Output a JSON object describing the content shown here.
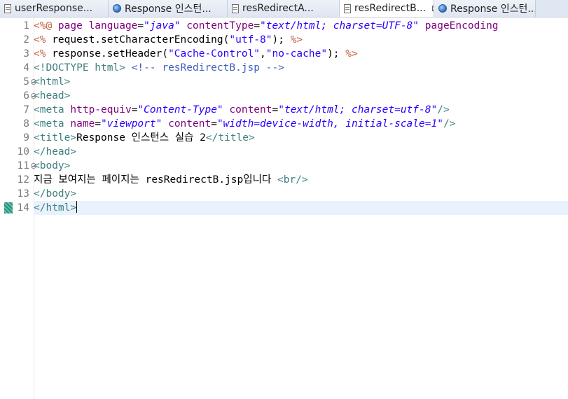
{
  "tabs": [
    {
      "label": "userResponse...",
      "icon": "jsp-file-icon",
      "active": false
    },
    {
      "label": "Response 인스턴...",
      "icon": "globe-icon",
      "active": false
    },
    {
      "label": "resRedirectA...",
      "icon": "jsp-file-icon",
      "active": false
    },
    {
      "label": "resRedirectB...",
      "icon": "jsp-file-icon",
      "active": true,
      "close": "⊠"
    },
    {
      "label": "Response 인스턴...",
      "icon": "globe-icon",
      "active": false
    }
  ],
  "editor": {
    "current_line": 14,
    "lines": [
      {
        "num": "1",
        "tokens": [
          [
            "dir",
            "<%@ "
          ],
          [
            "attr",
            "page "
          ],
          [
            "attr",
            "language"
          ],
          [
            "txt",
            "="
          ],
          [
            "stri",
            "\"java\""
          ],
          [
            "txt",
            " "
          ],
          [
            "attr",
            "contentType"
          ],
          [
            "txt",
            "="
          ],
          [
            "stri",
            "\"text/html; charset=UTF-8\""
          ],
          [
            "txt",
            " "
          ],
          [
            "attr",
            "pageEncoding"
          ]
        ]
      },
      {
        "num": "2",
        "tokens": [
          [
            "dir",
            "<% "
          ],
          [
            "java",
            "request.setCharacterEncoding("
          ],
          [
            "str",
            "\"utf-8\""
          ],
          [
            "java",
            "); "
          ],
          [
            "dir",
            "%>"
          ]
        ]
      },
      {
        "num": "3",
        "tokens": [
          [
            "dir",
            "<% "
          ],
          [
            "java",
            "response.setHeader("
          ],
          [
            "str",
            "\"Cache-Control\""
          ],
          [
            "java",
            ","
          ],
          [
            "str",
            "\"no-cache\""
          ],
          [
            "java",
            "); "
          ],
          [
            "dir",
            "%>"
          ]
        ]
      },
      {
        "num": "4",
        "tokens": [
          [
            "tag",
            "<!DOCTYPE html> "
          ],
          [
            "cmt",
            "<!-- resRedirectB.jsp -->"
          ]
        ]
      },
      {
        "num": "5",
        "fold": true,
        "tokens": [
          [
            "tag",
            "<html>"
          ]
        ]
      },
      {
        "num": "6",
        "fold": true,
        "tokens": [
          [
            "tag",
            "<head>"
          ]
        ]
      },
      {
        "num": "7",
        "tokens": [
          [
            "tag",
            "<meta "
          ],
          [
            "attr",
            "http-equiv"
          ],
          [
            "txt",
            "="
          ],
          [
            "stri",
            "\"Content-Type\""
          ],
          [
            "txt",
            " "
          ],
          [
            "attr",
            "content"
          ],
          [
            "txt",
            "="
          ],
          [
            "stri",
            "\"text/html; charset=utf-8\""
          ],
          [
            "tag",
            "/>"
          ]
        ]
      },
      {
        "num": "8",
        "tokens": [
          [
            "tag",
            "<meta "
          ],
          [
            "attr",
            "name"
          ],
          [
            "txt",
            "="
          ],
          [
            "stri",
            "\"viewport\""
          ],
          [
            "txt",
            " "
          ],
          [
            "attr",
            "content"
          ],
          [
            "txt",
            "="
          ],
          [
            "stri",
            "\"width=device-width, initial-scale=1\""
          ],
          [
            "tag",
            "/>"
          ]
        ]
      },
      {
        "num": "9",
        "tokens": [
          [
            "tag",
            "<title>"
          ],
          [
            "txt",
            "Response 인스턴스 실습 2"
          ],
          [
            "tag",
            "</title>"
          ]
        ]
      },
      {
        "num": "10",
        "tokens": [
          [
            "tag",
            "</head>"
          ]
        ]
      },
      {
        "num": "11",
        "fold": true,
        "tokens": [
          [
            "tag",
            "<body>"
          ]
        ]
      },
      {
        "num": "12",
        "tokens": [
          [
            "txt",
            "지금 보여지는 페이지는 resRedirectB.jsp입니다 "
          ],
          [
            "tag",
            "<br/>"
          ]
        ]
      },
      {
        "num": "13",
        "tokens": [
          [
            "tag",
            "</body>"
          ]
        ]
      },
      {
        "num": "14",
        "tokens": [
          [
            "tag",
            "</html>"
          ]
        ],
        "caret": true
      }
    ]
  }
}
